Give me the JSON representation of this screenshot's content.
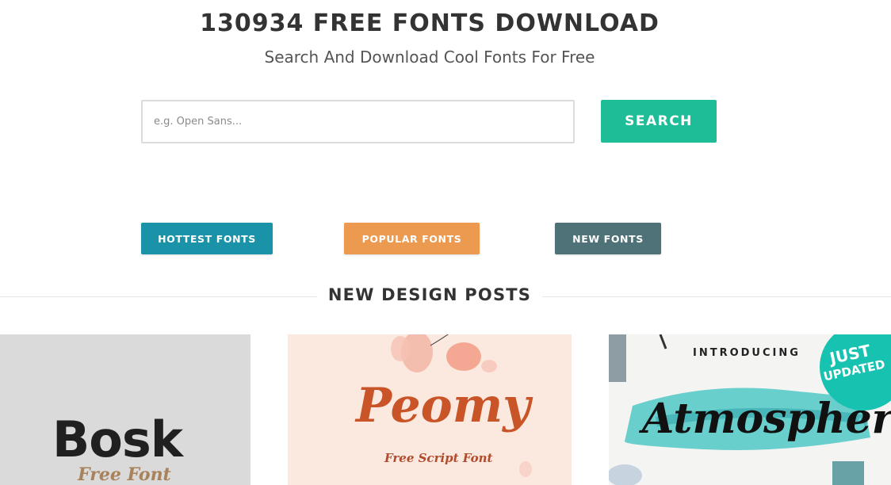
{
  "hero": {
    "title": "130934 FREE FONTS DOWNLOAD",
    "subtitle": "Search And Download Cool Fonts For Free"
  },
  "search": {
    "placeholder": "e.g. Open Sans...",
    "value": "",
    "button_label": "SEARCH"
  },
  "categories": [
    {
      "label": "HOTTEST FONTS",
      "color": "#1a93a8"
    },
    {
      "label": "POPULAR FONTS",
      "color": "#eb9a4f"
    },
    {
      "label": "NEW FONTS",
      "color": "#4e7278"
    }
  ],
  "section": {
    "title": "NEW DESIGN POSTS"
  },
  "posts": [
    {
      "logo": "Bosk",
      "subtitle": "Free Font"
    },
    {
      "logo": "Peomy",
      "subtitle": "Free Script Font"
    },
    {
      "intro": "INTRODUCING",
      "logo": "Atmosphere",
      "badge_line1": "JUST",
      "badge_line2": "UPDATED"
    }
  ],
  "colors": {
    "accent": "#1fbc98",
    "text": "#333333"
  }
}
